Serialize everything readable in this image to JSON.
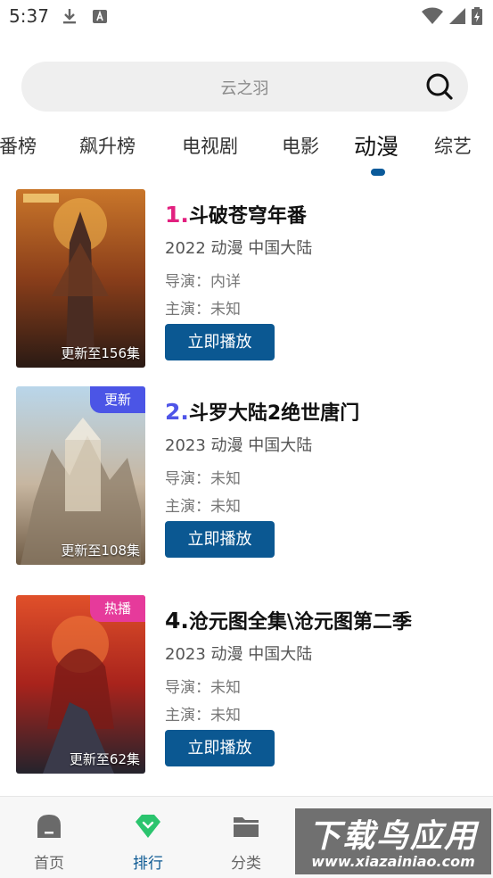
{
  "status_bar": {
    "time": "5:37",
    "icons_left": [
      "download-icon",
      "keyboard-icon"
    ],
    "icons_right": [
      "wifi-icon",
      "signal-icon",
      "battery-icon"
    ]
  },
  "search": {
    "placeholder": "云之羽",
    "icon": "search-icon"
  },
  "tabs": [
    {
      "label": "番榜",
      "active": false
    },
    {
      "label": "飙升榜",
      "active": false
    },
    {
      "label": "电视剧",
      "active": false
    },
    {
      "label": "电影",
      "active": false
    },
    {
      "label": "动漫",
      "active": true
    },
    {
      "label": "综艺",
      "active": false
    }
  ],
  "items": [
    {
      "rank": "1.",
      "rank_color": "#e2207f",
      "title": "斗破苍穹年番",
      "meta": "2022  动漫  中国大陆",
      "director": "导演：内详",
      "actor": "主演：未知",
      "button": "立即播放",
      "caption": "更新至156集",
      "badge": ""
    },
    {
      "rank": "2.",
      "rank_color": "#4f55e8",
      "title": "斗罗大陆2绝世唐门",
      "meta": "2023  动漫  中国大陆",
      "director": "导演：未知",
      "actor": "主演：未知",
      "button": "立即播放",
      "caption": "更新至108集",
      "badge": "更新"
    },
    {
      "rank": "4.",
      "rank_color": "#111111",
      "title": "沧元图全集\\沧元图第二季",
      "meta": "2023  动漫  中国大陆",
      "director": "导演：未知",
      "actor": "主演：未知",
      "button": "立即播放",
      "caption": "更新至62集",
      "badge": "热播"
    }
  ],
  "bottom_nav": [
    {
      "label": "首页",
      "icon": "home-icon",
      "active": false
    },
    {
      "label": "排行",
      "icon": "ranking-icon",
      "active": true
    },
    {
      "label": "分类",
      "icon": "folder-icon",
      "active": false
    }
  ],
  "watermark": {
    "title": "下载鸟应用",
    "url": "www.xiazainiao.com"
  },
  "colors": {
    "accent": "#0b5892",
    "tab_indicator": "#0a5a9a"
  }
}
